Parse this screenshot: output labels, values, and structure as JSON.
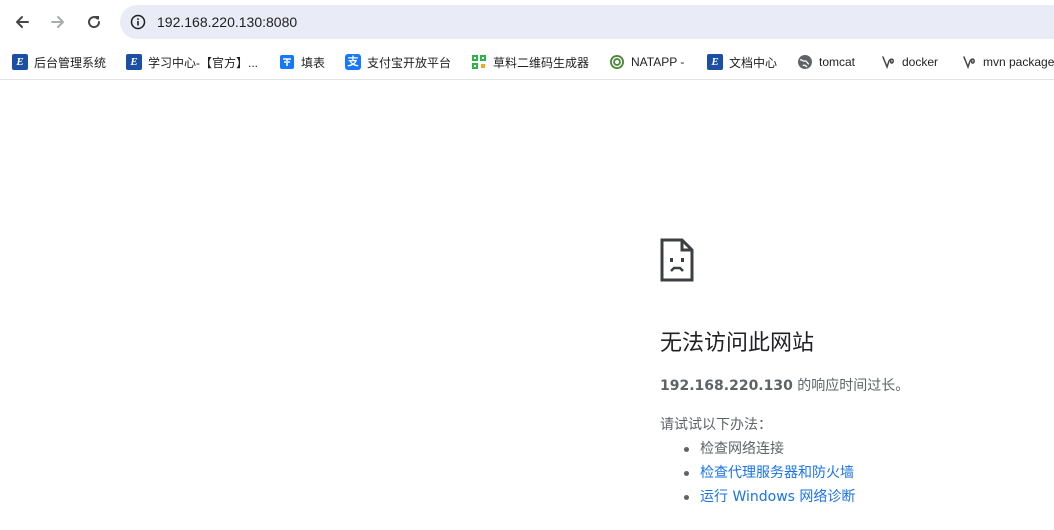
{
  "browser": {
    "url": "192.168.220.130:8080",
    "nav": {
      "back_icon": "arrow-left-icon",
      "forward_icon": "arrow-right-icon",
      "reload_icon": "reload-icon",
      "info_icon": "info-icon"
    },
    "bookmarks": [
      {
        "label": "后台管理系统",
        "icon": "e-logo-icon"
      },
      {
        "label": "学习中心-【官方】...",
        "icon": "e-logo-icon"
      },
      {
        "label": "填表",
        "icon": "form-icon"
      },
      {
        "label": "支付宝开放平台",
        "icon": "alipay-icon"
      },
      {
        "label": "草料二维码生成器",
        "icon": "qrcode-icon"
      },
      {
        "label": "NATAPP -",
        "icon": "natapp-icon"
      },
      {
        "label": "文档中心",
        "icon": "e-logo-icon"
      },
      {
        "label": "tomcat",
        "icon": "globe-icon"
      },
      {
        "label": "docker",
        "icon": "spiral-icon"
      },
      {
        "label": "mvn package",
        "icon": "spiral-icon"
      }
    ]
  },
  "error_page": {
    "icon": "sad-document-icon",
    "title": "无法访问此网站",
    "host": "192.168.220.130",
    "description_suffix": " 的响应时间过长。",
    "try_label": "请试试以下办法：",
    "suggestions": [
      {
        "label": "检查网络连接",
        "link": false
      },
      {
        "label": "检查代理服务器和防火墙",
        "link": true
      },
      {
        "label": "运行 Windows 网络诊断",
        "link": true
      }
    ]
  },
  "colors": {
    "omnibox_bg": "#e9ebf6",
    "link": "#1a73e8",
    "secondary_text": "#5f6368",
    "e_logo": "#1a4fa3"
  }
}
